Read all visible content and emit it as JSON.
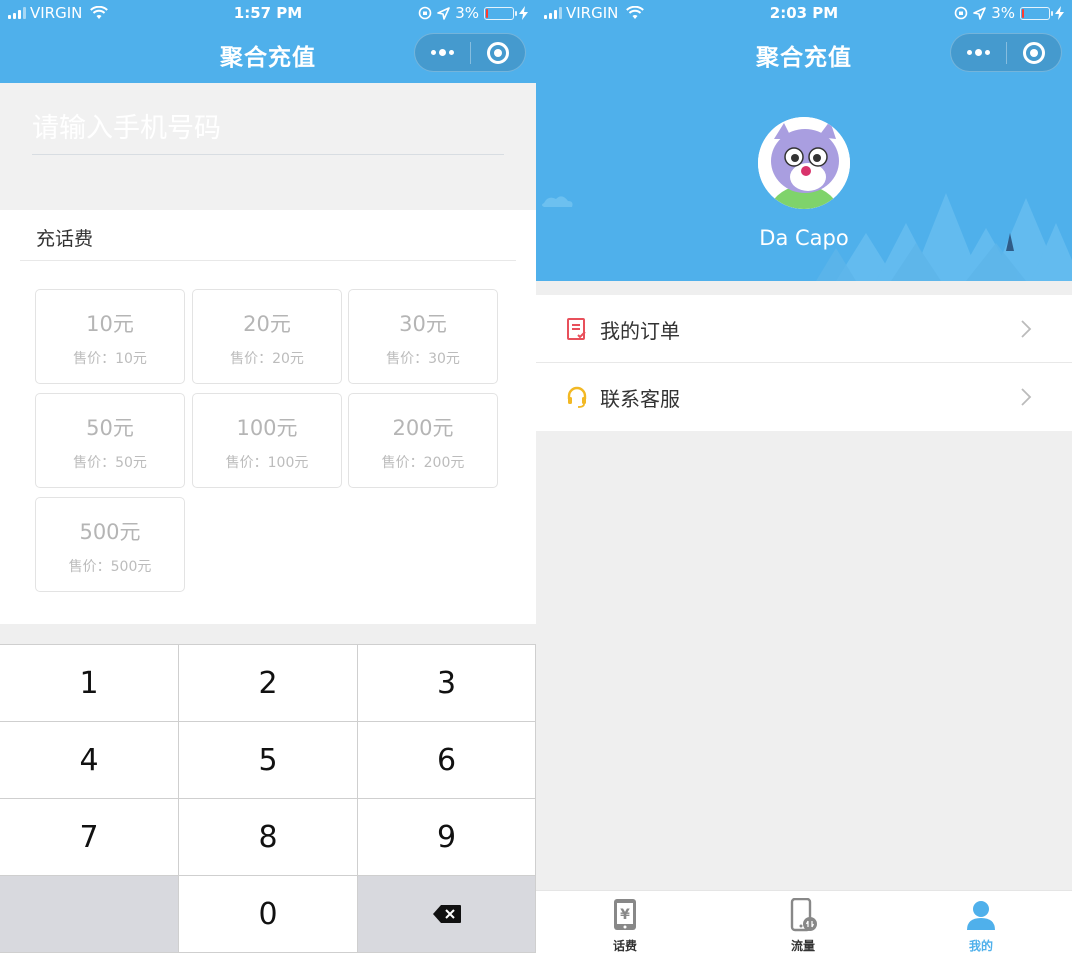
{
  "colors": {
    "brand": "#4fb0eb",
    "background": "#efefef",
    "battery_low": "#ff3b30",
    "tab_active": "#4fb0eb"
  },
  "left": {
    "status": {
      "carrier": "VIRGIN",
      "time": "1:57 PM",
      "battery": "3%",
      "battery_level": 0.03
    },
    "nav": {
      "title": "聚合充值"
    },
    "phone": {
      "placeholder": "请输入手机号码",
      "value": ""
    },
    "section": {
      "title": "充话费"
    },
    "options": [
      {
        "face": "10元",
        "price": "售价：10元"
      },
      {
        "face": "20元",
        "price": "售价：20元"
      },
      {
        "face": "30元",
        "price": "售价：30元"
      },
      {
        "face": "50元",
        "price": "售价：50元"
      },
      {
        "face": "100元",
        "price": "售价：100元"
      },
      {
        "face": "200元",
        "price": "售价：200元"
      },
      {
        "face": "500元",
        "price": "售价：500元"
      }
    ],
    "keypad": [
      "1",
      "2",
      "3",
      "4",
      "5",
      "6",
      "7",
      "8",
      "9",
      "",
      "0",
      "backspace-icon"
    ]
  },
  "right": {
    "status": {
      "carrier": "VIRGIN",
      "time": "2:03 PM",
      "battery": "3%",
      "battery_level": 0.03
    },
    "nav": {
      "title": "聚合充值"
    },
    "profile": {
      "nickname": "Da Capo",
      "avatar": "cartoon-avatar-icon"
    },
    "menu": [
      {
        "label": "我的订单",
        "icon": "order-icon"
      },
      {
        "label": "联系客服",
        "icon": "headset-icon"
      }
    ],
    "tabs": [
      {
        "label": "话费",
        "icon": "yen-phone-icon",
        "active": false
      },
      {
        "label": "流量",
        "icon": "data-phone-icon",
        "active": false
      },
      {
        "label": "我的",
        "icon": "user-icon",
        "active": true
      }
    ]
  }
}
